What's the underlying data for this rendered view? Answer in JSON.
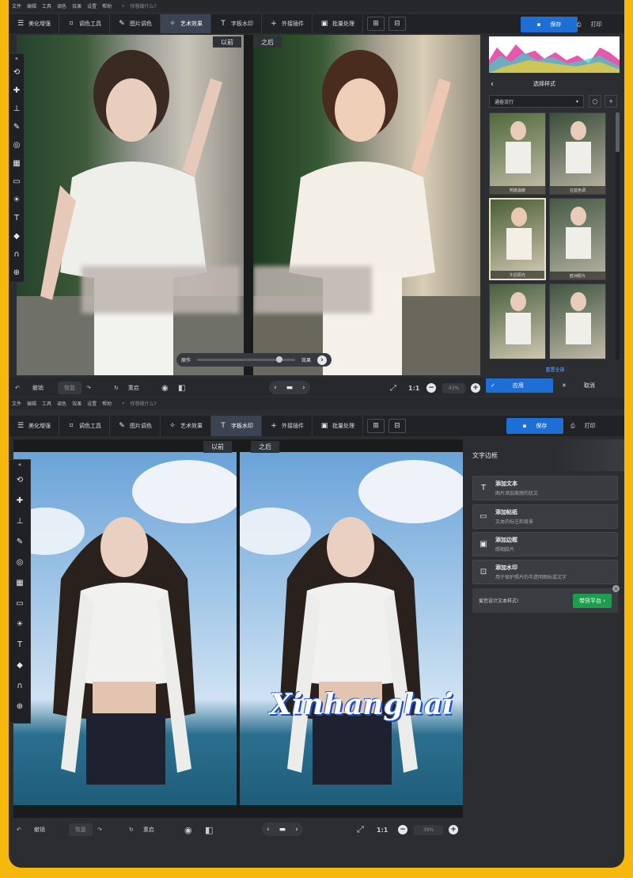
{
  "menu": [
    "文件",
    "编辑",
    "工具",
    "调色",
    "效果",
    "设置",
    "帮助"
  ],
  "search_placeholder": "你想做什么?",
  "toolbar": {
    "tabs": [
      "美化增强",
      "调色工具",
      "图片调色",
      "艺术效果",
      "字板水印",
      "外接插件",
      "批量处理"
    ],
    "save": "保存",
    "print": "打印"
  },
  "top": {
    "active_tab": "艺术效果",
    "before_label": "以前",
    "after_label": "之后",
    "slider_left": "原作",
    "slider_right": "效果",
    "bottom": {
      "undo": "撤销",
      "redo": "恢复",
      "reset": "重启",
      "ratio": "1:1",
      "zoom": "43%"
    },
    "panel": {
      "title": "选择样式",
      "category": "通俗流行",
      "styles": [
        "明澈温暖",
        "在蓝色调",
        "午后阳光",
        "欧洲胶片",
        "",
        ""
      ],
      "reset_all": "重置全部",
      "apply": "应用",
      "cancel": "取消"
    }
  },
  "bottom_ui": {
    "active_tab": "字板水印",
    "before_label": "以前",
    "after_label": "之后",
    "watermark_text": "Xinhanghai",
    "bottom": {
      "undo": "撤销",
      "redo": "恢复",
      "reset": "重启",
      "ratio": "1:1",
      "zoom": "39%"
    },
    "panel": {
      "title": "文字边框",
      "items": [
        {
          "title": "添加文本",
          "subtitle": "图片添加美丽的犹文"
        },
        {
          "title": "添加帖纸",
          "subtitle": "文本的标注和背景"
        },
        {
          "title": "添加边框",
          "subtitle": "照相胶片"
        },
        {
          "title": "添加水印",
          "subtitle": "用于保护照片的半透明图标或文字"
        }
      ],
      "promo_text": "爱您设计文本样式!",
      "promo_button": "带货平台"
    }
  },
  "colors": {
    "accent": "#1d6fd6",
    "frame": "#f6b80d",
    "promo": "#1f9c4f"
  }
}
